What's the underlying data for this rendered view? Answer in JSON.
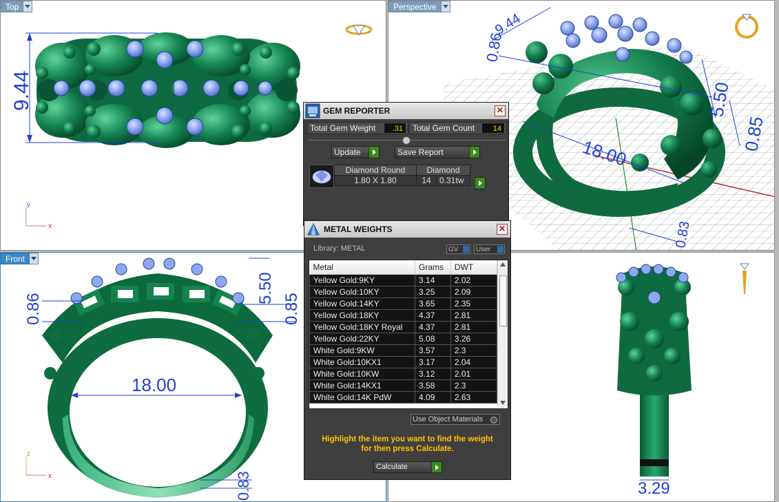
{
  "viewports": {
    "top": {
      "label": "Top",
      "dim_height": "9.44",
      "axis_a": "y",
      "axis_b": "x"
    },
    "perspective": {
      "label": "Perspective",
      "dim_1": "9.44",
      "dim_2": "0.86",
      "dim_3": "5.50",
      "dim_4": "0.85",
      "dim_5": "18.00",
      "dim_6": "0.83"
    },
    "front": {
      "label": "Front",
      "dim_left": "0.86",
      "dim_right_a": "5.50",
      "dim_right_b": "0.85",
      "dim_diameter": "18.00",
      "dim_bottom": "0.83",
      "axis_a": "z",
      "axis_b": "x"
    },
    "right": {
      "dim_width": "3.29"
    }
  },
  "gem_reporter": {
    "title": "GEM REPORTER",
    "total_weight_label": "Total Gem Weight",
    "total_weight_value": ".31",
    "total_count_label": "Total Gem Count",
    "total_count_value": "14",
    "update_label": "Update",
    "save_report_label": "Save Report",
    "table_headers": [
      "Diamond Round",
      "Diamond"
    ],
    "row": {
      "size": "1.80 X 1.80",
      "count": "14",
      "weight": "0.31tw"
    }
  },
  "metal_weights": {
    "title": "METAL WEIGHTS",
    "library_label": "Library: METAL",
    "gv_label": "GV",
    "user_label": "User",
    "columns": [
      "Metal",
      "Grams",
      "DWT"
    ],
    "rows": [
      {
        "metal": "Yellow Gold:9KY",
        "grams": "3.14",
        "dwt": "2.02"
      },
      {
        "metal": "Yellow Gold:10KY",
        "grams": "3.25",
        "dwt": "2.09"
      },
      {
        "metal": "Yellow Gold:14KY",
        "grams": "3.65",
        "dwt": "2.35"
      },
      {
        "metal": "Yellow Gold:18KY",
        "grams": "4.37",
        "dwt": "2.81"
      },
      {
        "metal": "Yellow Gold:18KY Royal",
        "grams": "4.37",
        "dwt": "2.81"
      },
      {
        "metal": "Yellow Gold:22KY",
        "grams": "5.08",
        "dwt": "3.26"
      },
      {
        "metal": "White Gold:9KW",
        "grams": "3.57",
        "dwt": "2.3"
      },
      {
        "metal": "White Gold:10KX1",
        "grams": "3.17",
        "dwt": "2.04"
      },
      {
        "metal": "White Gold:10KW",
        "grams": "3.12",
        "dwt": "2.01"
      },
      {
        "metal": "White Gold:14KX1",
        "grams": "3.58",
        "dwt": "2.3"
      },
      {
        "metal": "White Gold:14K PdW",
        "grams": "4.09",
        "dwt": "2.63"
      }
    ],
    "use_object_materials_label": "Use Object Materials",
    "hint_line1": "Highlight the item you want to find the weight",
    "hint_line2": "for then press Calculate.",
    "calculate_label": "Calculate"
  },
  "colors": {
    "metal": "#1a7a52",
    "gem": "#8fa8f0",
    "dimension": "#1f3fd6",
    "accent": "#3d87c7"
  }
}
